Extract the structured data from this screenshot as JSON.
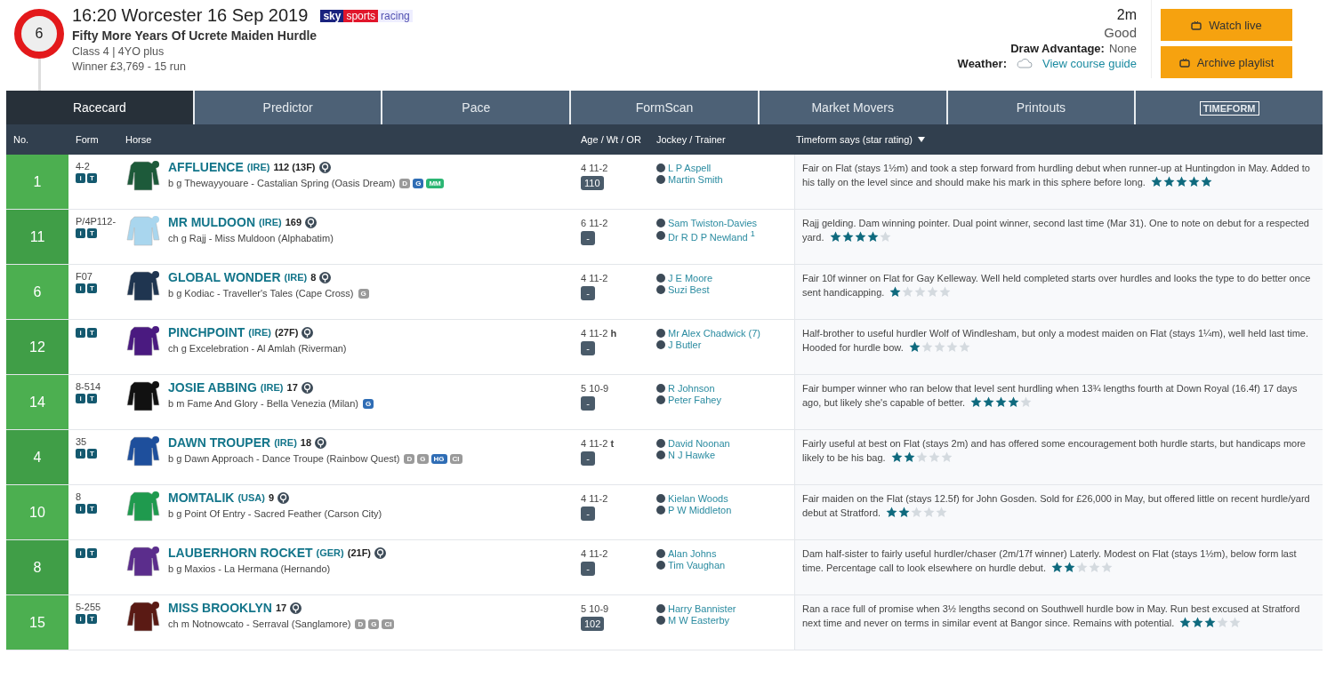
{
  "race": {
    "number": "6",
    "title": "16:20 Worcester 16 Sep 2019",
    "broadcaster": [
      "sky",
      "sports",
      "racing"
    ],
    "name": "Fifty More Years Of Ucrete Maiden Hurdle",
    "class": "Class 4 | 4YO plus",
    "prize": "Winner £3,769 - 15 run",
    "distance": "2m",
    "going": "Good",
    "draw_label": "Draw Advantage:",
    "draw_value": "None",
    "weather_label": "Weather:",
    "course_link": "View course guide"
  },
  "buttons": [
    "Watch live",
    "Archive playlist"
  ],
  "tabs": [
    {
      "label": "Racecard",
      "selected": true,
      "kind": "text"
    },
    {
      "label": "Predictor",
      "selected": false,
      "kind": "text"
    },
    {
      "label": "Pace",
      "selected": false,
      "kind": "text"
    },
    {
      "label": "FormScan",
      "selected": false,
      "kind": "text"
    },
    {
      "label": "Market Movers",
      "selected": false,
      "kind": "text"
    },
    {
      "label": "Printouts",
      "selected": false,
      "kind": "text"
    },
    {
      "label": "TIMEFORM",
      "selected": false,
      "kind": "logo"
    }
  ],
  "columns": [
    "No.",
    "Form",
    "Horse",
    "Age / Wt / OR",
    "Jockey / Trainer",
    "Timeform says (star rating)"
  ],
  "runners": [
    {
      "number": "1",
      "form": "4-2",
      "buttons": [
        "i",
        "T"
      ],
      "color": "#1d5a3a",
      "name": "AFFLUENCE",
      "origin": "(IRE)",
      "rating": "112 (13F)",
      "breeding": "b g Thewayyouare - Castalian Spring (Oasis Dream)",
      "tags": [
        {
          "label": "D",
          "color": "#9a9a9a"
        },
        {
          "label": "G",
          "color": "#2f6db5"
        },
        {
          "label": "MM",
          "color": "#2bb673"
        }
      ],
      "age_wt": "4 11-2",
      "or": "110",
      "jockey": "L P Aspell",
      "trainer": "Martin Smith",
      "comment": "Fair on Flat (stays 1½m) and took a step forward from hurdling debut when runner-up at Huntingdon in May. Added to his tally on the level since and should make his mark in this sphere before long.",
      "stars": 5
    },
    {
      "number": "11",
      "form": "P/4P112-",
      "buttons": [
        "i",
        "T"
      ],
      "color": "#a9d6ee",
      "name": "MR MULDOON",
      "origin": "(IRE)",
      "rating": "169",
      "breeding": "ch g Rajj - Miss Muldoon (Alphabatim)",
      "age_wt": "6 11-2",
      "or": "-",
      "jockey": "Sam Twiston-Davies",
      "trainer": "Dr R D P Newland $^{1}$",
      "comment": "Rajj gelding. Dam winning pointer. Dual point winner, second last time (Mar 31). One to note on debut for a respected yard.",
      "stars": 4
    },
    {
      "number": "6",
      "form": "F07",
      "buttons": [
        "i",
        "T"
      ],
      "color": "#1f3550",
      "name": "GLOBAL WONDER",
      "origin": "(IRE)",
      "rating": "8",
      "breeding": "b g Kodiac - Traveller's Tales (Cape Cross)",
      "tags": [
        {
          "label": "G",
          "color": "#9a9a9a"
        }
      ],
      "age_wt": "4 11-2",
      "or": "-",
      "jockey": "J E Moore",
      "trainer": "Suzi Best",
      "comment": "Fair 10f winner on Flat for Gay Kelleway. Well held completed starts over hurdles and looks the type to do better once sent handicapping.",
      "stars": 1
    },
    {
      "number": "12",
      "buttons": [
        "i",
        "T"
      ],
      "color": "#4a1a80",
      "name": "PINCHPOINT",
      "origin": "(IRE)",
      "rating": "(27F)",
      "breeding": "ch g Excelebration - Al Amlah (Riverman)",
      "age_wt": "4 11-2 **h**",
      "or": "-",
      "jockey": "Mr Alex Chadwick (7)",
      "trainer": "J Butler",
      "comment": "Half-brother to useful hurdler Wolf of Windlesham, but only a modest maiden on Flat (stays 1¼m), well held last time. Hooded for hurdle bow.",
      "stars": 1
    },
    {
      "number": "14",
      "form": "8-514",
      "buttons": [
        "i",
        "T"
      ],
      "color": "#111111",
      "name": "JOSIE ABBING",
      "origin": "(IRE)",
      "rating": "17",
      "breeding": "b m Fame And Glory - Bella Venezia (Milan)",
      "tags": [
        {
          "label": "G",
          "color": "#2f6db5"
        }
      ],
      "age_wt": "5 10-9",
      "or": "-",
      "jockey": "R Johnson",
      "trainer": "Peter Fahey",
      "comment": "Fair bumper winner who ran below that level sent hurdling when 13¾ lengths fourth at Down Royal (16.4f) 17 days ago, but likely she's capable of better.",
      "stars": 4
    },
    {
      "number": "4",
      "form": "35",
      "buttons": [
        "i",
        "T"
      ],
      "color": "#1e4f9c",
      "name": "DAWN TROUPER",
      "origin": "(IRE)",
      "rating": "18",
      "breeding": "b g Dawn Approach - Dance Troupe (Rainbow Quest)",
      "tags": [
        {
          "label": "D",
          "color": "#9a9a9a"
        },
        {
          "label": "G",
          "color": "#9a9a9a"
        },
        {
          "label": "HG",
          "color": "#2f6db5"
        },
        {
          "label": "CI",
          "color": "#9a9a9a"
        }
      ],
      "age_wt": "4 11-2 **t**",
      "or": "-",
      "jockey": "David Noonan",
      "trainer": "N J Hawke",
      "comment": "Fairly useful at best on Flat (stays 2m) and has offered some encouragement both hurdle starts, but handicaps more likely to be his bag.",
      "stars": 2
    },
    {
      "number": "10",
      "form": "8",
      "buttons": [
        "i",
        "T"
      ],
      "color": "#1f9a4e",
      "name": "MOMTALIK",
      "origin": "(USA)",
      "rating": "9",
      "breeding": "b g Point Of Entry - Sacred Feather (Carson City)",
      "age_wt": "4 11-2",
      "or": "-",
      "jockey": "Kielan Woods",
      "trainer": "P W Middleton",
      "comment": "Fair maiden on the Flat (stays 12.5f) for John Gosden. Sold for £26,000 in May, but offered little on recent hurdle/yard debut at Stratford.",
      "stars": 2
    },
    {
      "number": "8",
      "buttons": [
        "i",
        "T"
      ],
      "color": "#5b2d8c",
      "name": "LAUBERHORN ROCKET",
      "origin": "(GER)",
      "rating": "(21F)",
      "breeding": "b g Maxios - La Hermana (Hernando)",
      "age_wt": "4 11-2",
      "or": "-",
      "jockey": "Alan Johns",
      "trainer": "Tim Vaughan",
      "comment": "Dam half-sister to fairly useful hurdler/chaser (2m/17f winner) Laterly. Modest on Flat (stays 1½m), below form last time. Percentage call to look elsewhere on hurdle debut.",
      "stars": 2
    },
    {
      "number": "15",
      "form": "5-255",
      "buttons": [
        "i",
        "T"
      ],
      "color": "#5a1a14",
      "name": "MISS BROOKLYN",
      "rating": "17",
      "breeding": "ch m Notnowcato - Serraval (Sanglamore)",
      "tags": [
        {
          "label": "D",
          "color": "#9a9a9a"
        },
        {
          "label": "G",
          "color": "#9a9a9a"
        },
        {
          "label": "CI",
          "color": "#9a9a9a"
        }
      ],
      "age_wt": "5 10-9",
      "or": "102",
      "jockey": "Harry Bannister",
      "trainer": "M W Easterby",
      "comment": "Ran a race full of promise when 3½ lengths second on Southwell hurdle bow in May. Run best excused at Stratford next time and never on terms in similar event at Bangor since. Remains with potential.",
      "stars": 3
    }
  ]
}
